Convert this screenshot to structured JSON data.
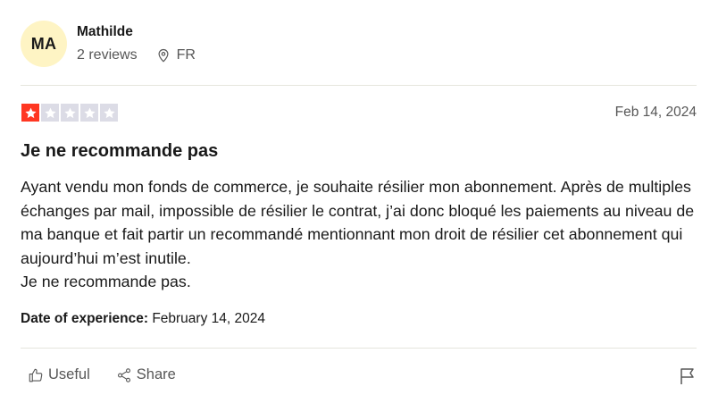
{
  "reviewer": {
    "initials": "MA",
    "name": "Mathilde",
    "review_count": "2 reviews",
    "country": "FR"
  },
  "review": {
    "rating": 1,
    "max_rating": 5,
    "star_color_filled": "#ff3722",
    "star_color_empty": "#dcdce6",
    "date": "Feb 14, 2024",
    "title": "Je ne recommande pas",
    "body_lines": [
      "Ayant vendu mon fonds de commerce, je souhaite résilier mon abonnement. Après de multiples échanges par mail, impossible de résilier le contrat, j’ai donc bloqué les paiements au niveau de ma banque et fait partir un recommandé mentionnant mon droit de résilier cet abonnement qui aujourd’hui m’est inutile.",
      "Je ne recommande pas."
    ],
    "experience_label": "Date of experience:",
    "experience_date": "February 14, 2024"
  },
  "actions": {
    "useful_label": "Useful",
    "share_label": "Share",
    "useful_icon": "thumbs-up-icon",
    "share_icon": "share-icon",
    "flag_icon": "flag-icon"
  }
}
